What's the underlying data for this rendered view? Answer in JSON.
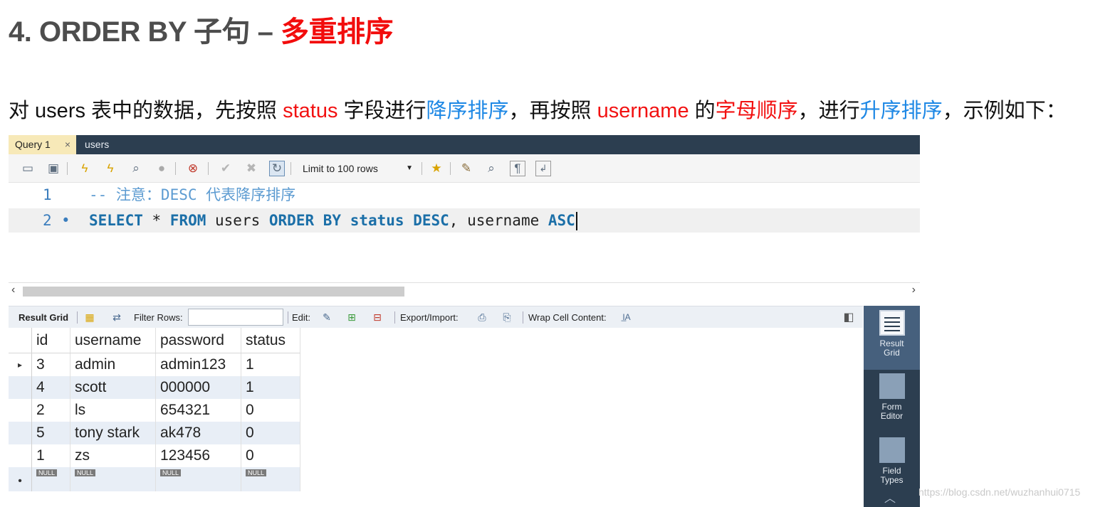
{
  "heading": {
    "prefix": "4. ORDER BY 子句 – ",
    "highlight": "多重排序",
    "highlight_color": "#f20c0c"
  },
  "description": {
    "segments": [
      {
        "text": "对 users 表中的数据，先按照 ",
        "color": "plain"
      },
      {
        "text": "status",
        "color": "red"
      },
      {
        "text": " 字段进行",
        "color": "plain"
      },
      {
        "text": "降序排序",
        "color": "blue"
      },
      {
        "text": "，再按照 ",
        "color": "plain"
      },
      {
        "text": "username",
        "color": "red"
      },
      {
        "text": " 的",
        "color": "plain"
      },
      {
        "text": "字母顺序",
        "color": "red"
      },
      {
        "text": "，进行",
        "color": "plain"
      },
      {
        "text": "升序排序",
        "color": "blue"
      },
      {
        "text": "，示例如下：",
        "color": "plain"
      }
    ]
  },
  "tabs": [
    {
      "label": "Query 1",
      "active": true,
      "close": "×"
    },
    {
      "label": "users",
      "active": false
    }
  ],
  "toolbar": {
    "icons": [
      "open-folder-icon",
      "save-icon",
      "execute-icon",
      "execute-current-icon",
      "explain-icon",
      "stop-icon",
      "toggle-error-icon",
      "commit-icon",
      "rollback-icon",
      "autocommit-icon",
      "beautify-icon",
      "find-icon",
      "invisible-chars-icon",
      "wrap-icon"
    ],
    "limit_label": "Limit to 100 rows"
  },
  "editor": {
    "line1_no": "1",
    "line1_text": "-- 注意：DESC 代表降序排序",
    "line2_no": "2",
    "line2_dot": "•",
    "line2_tokens": [
      {
        "t": "SELECT",
        "k": "kw"
      },
      {
        "t": " * ",
        "k": "txt"
      },
      {
        "t": "FROM",
        "k": "kw"
      },
      {
        "t": " users ",
        "k": "txt"
      },
      {
        "t": "ORDER BY",
        "k": "kw"
      },
      {
        "t": " ",
        "k": "txt"
      },
      {
        "t": "status",
        "k": "kw"
      },
      {
        "t": " ",
        "k": "txt"
      },
      {
        "t": "DESC",
        "k": "kw"
      },
      {
        "t": ", username ",
        "k": "txt"
      },
      {
        "t": "ASC",
        "k": "kw"
      }
    ]
  },
  "result_toolbar": {
    "result_grid": "Result Grid",
    "filter_rows": "Filter Rows:",
    "filter_value": "",
    "edit": "Edit:",
    "export_import": "Export/Import:",
    "wrap_cell": "Wrap Cell Content:"
  },
  "grid": {
    "columns": [
      "id",
      "username",
      "password",
      "status"
    ],
    "rows": [
      [
        "3",
        "admin",
        "admin123",
        "1"
      ],
      [
        "4",
        "scott",
        "000000",
        "1"
      ],
      [
        "2",
        "ls",
        "654321",
        "0"
      ],
      [
        "5",
        "tony stark",
        "ak478",
        "0"
      ],
      [
        "1",
        "zs",
        "123456",
        "0"
      ]
    ],
    "current_marker": "▸",
    "new_row_marker": "•",
    "null_label": "NULL"
  },
  "sidebar": {
    "items": [
      {
        "label_1": "Result",
        "label_2": "Grid",
        "active": true
      },
      {
        "label_1": "Form",
        "label_2": "Editor",
        "active": false
      },
      {
        "label_1": "Field",
        "label_2": "Types",
        "active": false
      }
    ]
  },
  "watermark": "https://blog.csdn.net/wuzhanhui0715",
  "colors": {
    "accent_red": "#f21111",
    "accent_blue": "#1e88e5",
    "keyword": "#1b6fa8",
    "comment": "#5c9bd1",
    "panel_dark": "#2c3e50"
  }
}
